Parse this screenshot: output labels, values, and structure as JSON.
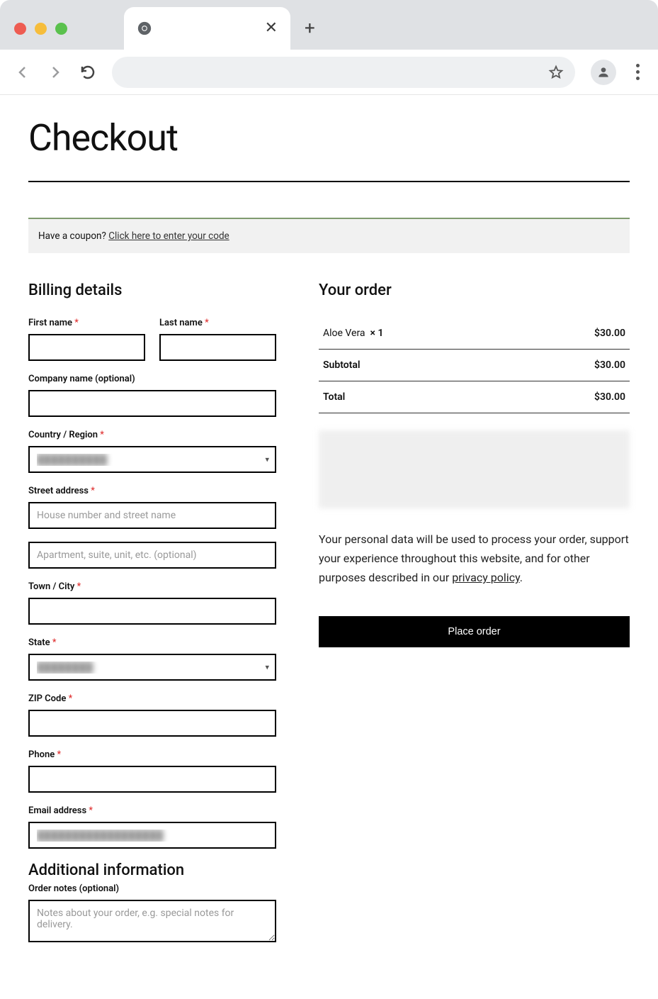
{
  "page": {
    "title": "Checkout"
  },
  "coupon": {
    "prompt": "Have a coupon?",
    "link_text": "Click here to enter your code"
  },
  "billing": {
    "heading": "Billing details",
    "first_name_label": "First name",
    "last_name_label": "Last name",
    "company_label": "Company name (optional)",
    "country_label": "Country / Region",
    "country_value": "██████████",
    "street_label": "Street address",
    "street_placeholder": "House number and street name",
    "street2_placeholder": "Apartment, suite, unit, etc. (optional)",
    "city_label": "Town / City",
    "state_label": "State",
    "state_value": "████████",
    "zip_label": "ZIP Code",
    "phone_label": "Phone",
    "email_label": "Email address",
    "email_value": "██████████████████"
  },
  "additional": {
    "heading": "Additional information",
    "notes_label": "Order notes (optional)",
    "notes_placeholder": "Notes about your order, e.g. special notes for delivery."
  },
  "order": {
    "heading": "Your order",
    "item_name": "Aloe Vera",
    "item_qty": "× 1",
    "item_total": "$30.00",
    "subtotal_label": "Subtotal",
    "subtotal_value": "$30.00",
    "total_label": "Total",
    "total_value": "$30.00",
    "privacy_text_pre": "Your personal data will be used to process your order, support your experience throughout this website, and for other purposes described in our ",
    "privacy_link": "privacy policy",
    "privacy_text_post": ".",
    "place_order_label": "Place order"
  }
}
